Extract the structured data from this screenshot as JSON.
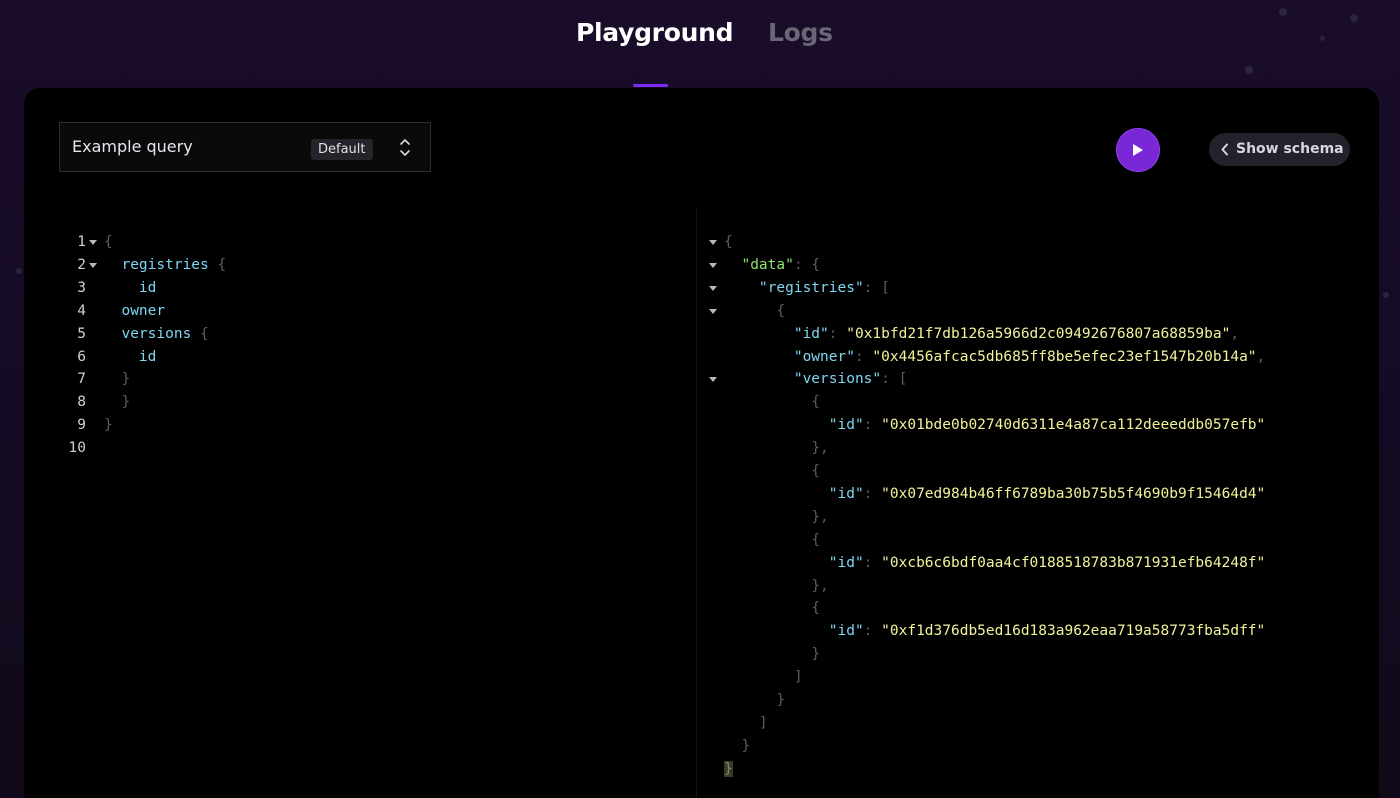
{
  "tabs": [
    {
      "label": "Playground",
      "active": true
    },
    {
      "label": "Logs",
      "active": false
    }
  ],
  "toolbar": {
    "query_name": "Example query",
    "query_badge": "Default",
    "run_icon": "play-icon",
    "schema_label": "Show schema",
    "schema_icon": "chevron-left-icon"
  },
  "colors": {
    "accent": "#7a27d6",
    "field": "#7fd6f0",
    "data_key": "#8ee36a",
    "string": "#f2f29a",
    "punctuation": "#5d5d5d"
  },
  "query_editor": {
    "line_numbers": [
      "1",
      "2",
      "3",
      "4",
      "5",
      "6",
      "7",
      "8",
      "9",
      "10"
    ],
    "lines": [
      {
        "tokens": [
          {
            "t": "{",
            "c": "punc"
          }
        ]
      },
      {
        "tokens": [
          {
            "t": "  "
          },
          {
            "t": "registries",
            "c": "field"
          },
          {
            "t": " "
          },
          {
            "t": "{",
            "c": "punc"
          }
        ]
      },
      {
        "tokens": [
          {
            "t": "    "
          },
          {
            "t": "id",
            "c": "field"
          }
        ]
      },
      {
        "tokens": [
          {
            "t": "  "
          },
          {
            "t": "owner",
            "c": "field"
          }
        ]
      },
      {
        "tokens": [
          {
            "t": "  "
          },
          {
            "t": "versions",
            "c": "field"
          },
          {
            "t": " "
          },
          {
            "t": "{",
            "c": "punc"
          }
        ]
      },
      {
        "tokens": [
          {
            "t": "    "
          },
          {
            "t": "id",
            "c": "field"
          }
        ]
      },
      {
        "tokens": [
          {
            "t": "  "
          },
          {
            "t": "}",
            "c": "punc"
          }
        ]
      },
      {
        "tokens": [
          {
            "t": "  "
          },
          {
            "t": "}",
            "c": "punc"
          }
        ]
      },
      {
        "tokens": [
          {
            "t": "}",
            "c": "punc"
          }
        ]
      },
      {
        "tokens": []
      }
    ]
  },
  "result_viewer": {
    "lines": [
      {
        "tokens": [
          {
            "t": "{",
            "c": "punc"
          }
        ]
      },
      {
        "tokens": [
          {
            "t": "  "
          },
          {
            "t": "\"data\"",
            "c": "key-data"
          },
          {
            "t": ": ",
            "c": "punc"
          },
          {
            "t": "{",
            "c": "punc"
          }
        ]
      },
      {
        "tokens": [
          {
            "t": "    "
          },
          {
            "t": "\"registries\"",
            "c": "key"
          },
          {
            "t": ": ",
            "c": "punc"
          },
          {
            "t": "[",
            "c": "punc"
          }
        ]
      },
      {
        "tokens": [
          {
            "t": "      "
          },
          {
            "t": "{",
            "c": "punc"
          }
        ]
      },
      {
        "tokens": [
          {
            "t": "        "
          },
          {
            "t": "\"id\"",
            "c": "key"
          },
          {
            "t": ": ",
            "c": "punc"
          },
          {
            "t": "\"0x1bfd21f7db126a5966d2c09492676807a68859ba\"",
            "c": "str"
          },
          {
            "t": ",",
            "c": "punc"
          }
        ]
      },
      {
        "tokens": [
          {
            "t": "        "
          },
          {
            "t": "\"owner\"",
            "c": "key"
          },
          {
            "t": ": ",
            "c": "punc"
          },
          {
            "t": "\"0x4456afcac5db685ff8be5efec23ef1547b20b14a\"",
            "c": "str"
          },
          {
            "t": ",",
            "c": "punc"
          }
        ]
      },
      {
        "tokens": [
          {
            "t": "        "
          },
          {
            "t": "\"versions\"",
            "c": "key"
          },
          {
            "t": ": ",
            "c": "punc"
          },
          {
            "t": "[",
            "c": "punc"
          }
        ]
      },
      {
        "tokens": [
          {
            "t": "          "
          },
          {
            "t": "{",
            "c": "punc"
          }
        ]
      },
      {
        "tokens": [
          {
            "t": "            "
          },
          {
            "t": "\"id\"",
            "c": "key"
          },
          {
            "t": ": ",
            "c": "punc"
          },
          {
            "t": "\"0x01bde0b02740d6311e4a87ca112deeeddb057efb\"",
            "c": "str"
          }
        ]
      },
      {
        "tokens": [
          {
            "t": "          "
          },
          {
            "t": "},",
            "c": "punc"
          }
        ]
      },
      {
        "tokens": [
          {
            "t": "          "
          },
          {
            "t": "{",
            "c": "punc"
          }
        ]
      },
      {
        "tokens": [
          {
            "t": "            "
          },
          {
            "t": "\"id\"",
            "c": "key"
          },
          {
            "t": ": ",
            "c": "punc"
          },
          {
            "t": "\"0x07ed984b46ff6789ba30b75b5f4690b9f15464d4\"",
            "c": "str"
          }
        ]
      },
      {
        "tokens": [
          {
            "t": "          "
          },
          {
            "t": "},",
            "c": "punc"
          }
        ]
      },
      {
        "tokens": [
          {
            "t": "          "
          },
          {
            "t": "{",
            "c": "punc"
          }
        ]
      },
      {
        "tokens": [
          {
            "t": "            "
          },
          {
            "t": "\"id\"",
            "c": "key"
          },
          {
            "t": ": ",
            "c": "punc"
          },
          {
            "t": "\"0xcb6c6bdf0aa4cf0188518783b871931efb64248f\"",
            "c": "str"
          }
        ]
      },
      {
        "tokens": [
          {
            "t": "          "
          },
          {
            "t": "},",
            "c": "punc"
          }
        ]
      },
      {
        "tokens": [
          {
            "t": "          "
          },
          {
            "t": "{",
            "c": "punc"
          }
        ]
      },
      {
        "tokens": [
          {
            "t": "            "
          },
          {
            "t": "\"id\"",
            "c": "key"
          },
          {
            "t": ": ",
            "c": "punc"
          },
          {
            "t": "\"0xf1d376db5ed16d183a962eaa719a58773fba5dff\"",
            "c": "str"
          }
        ]
      },
      {
        "tokens": [
          {
            "t": "          "
          },
          {
            "t": "}",
            "c": "punc"
          }
        ]
      },
      {
        "tokens": [
          {
            "t": "        "
          },
          {
            "t": "]",
            "c": "punc"
          }
        ]
      },
      {
        "tokens": [
          {
            "t": "      "
          },
          {
            "t": "}",
            "c": "punc"
          }
        ]
      },
      {
        "tokens": [
          {
            "t": "    "
          },
          {
            "t": "]",
            "c": "punc"
          }
        ]
      },
      {
        "tokens": [
          {
            "t": "  "
          },
          {
            "t": "}",
            "c": "punc"
          }
        ]
      },
      {
        "tokens": [
          {
            "t": "}",
            "c": "cursor-brace"
          }
        ]
      }
    ]
  }
}
